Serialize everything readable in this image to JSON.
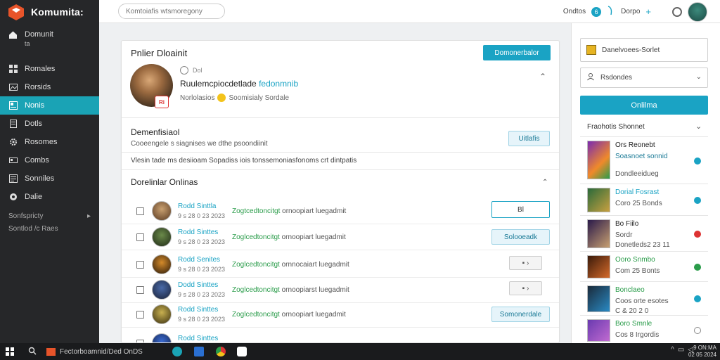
{
  "colors": {
    "accent": "#1aa3c4",
    "sidebar_bg": "#262729",
    "active_nav": "#1aa3b5",
    "green": "#2a9c4a"
  },
  "app": {
    "title": "Komumita:"
  },
  "sidebar": {
    "items": [
      {
        "label": "Domunit",
        "sublabel": "ta",
        "icon": "home-icon"
      },
      {
        "label": "Romales",
        "icon": "grid-icon"
      },
      {
        "label": "Rorsids",
        "icon": "gallery-icon"
      },
      {
        "label": "Nonis",
        "icon": "news-icon",
        "active": true
      },
      {
        "label": "Dotls",
        "icon": "document-icon"
      },
      {
        "label": "Rosomes",
        "icon": "gear-icon"
      },
      {
        "label": "Combs",
        "icon": "card-icon"
      },
      {
        "label": "Sonniles",
        "icon": "list-icon"
      },
      {
        "label": "Dalie",
        "icon": "circle-icon"
      }
    ],
    "group_1": "Sonfspricty",
    "group_2": "Sontlod /c Raes"
  },
  "topbar": {
    "search_placeholder": "Komtoiafis wtsmoregony",
    "link_1": "Ondtos",
    "link_2": "Dorpo"
  },
  "main": {
    "title": "Pnlier Dloainit",
    "primary_button": "Domonerbalor",
    "profile": {
      "meta": "Dol",
      "name": "Ruulemcpiocdetlade",
      "name_link": "fedonmnib",
      "sub_1": "Norlolasios",
      "sub_2": "Soomisialy Sordale",
      "badge": "Ri"
    },
    "section_1": {
      "title": "Demenfisiaol",
      "subtitle": "Cooeengele s siagnises we dthe psoondiinit",
      "button": "Uitlafis"
    },
    "description": "Vlesin tade ms desiioam Sopadiss iois tonssemoniasfonoms crt dintpatis",
    "section_2": {
      "title": "Dorelinlar Onlinas"
    },
    "rows": [
      {
        "name": "Rodd Sinttla",
        "time": "9 s 28 0 23 2023",
        "highlight": "Zogtcedtoncitgt",
        "desc": "ornoopiart luegadmit",
        "action": "Bl",
        "style": "outlined"
      },
      {
        "name": "Rodd Sinttes",
        "time": "9 s 28 0 23 2023",
        "highlight": "Zoglcedtoncitgt",
        "desc": "ornoopiart luegadmit",
        "action": "Solooeadk",
        "style": "soft"
      },
      {
        "name": "Rodd Senites",
        "time": "9 s 28 0 23 2023",
        "highlight": "Zoglcedtoncitgt",
        "desc": "ornnocaiart luegadmit",
        "action": "",
        "style": "grey"
      },
      {
        "name": "Dodd Sinttes",
        "time": "9 s 28 0 23 2023",
        "highlight": "Zoglcedtoncitgt",
        "desc": "ornoopiarst luegadmit",
        "action": "",
        "style": "grey"
      },
      {
        "name": "Rodd Sinttes",
        "time": "9 s 28 0 23 2023",
        "highlight": "Zoglcedtoncitgt",
        "desc": "ornoopiart luegadmit",
        "action": "Somonerdale",
        "style": "soft"
      },
      {
        "name": "Rodd Sinttes",
        "time": "9 s 28 0 23 2023",
        "highlight": "",
        "desc": "",
        "action": "",
        "style": "none"
      }
    ]
  },
  "right": {
    "box_1": "Danelvoees-Sorlet",
    "box_2": "Rsdondes",
    "primary_button": "Onlilma",
    "list_title": "Fraohotis Shonnet",
    "items": [
      {
        "title": "Ors Reonebt",
        "subtitle": "Soasnoet sonnid",
        "meta": "Dondleeidueg",
        "status": "blue"
      },
      {
        "title": "Dorial Fosrast",
        "subtitle": "Coro 25 Bonds",
        "meta": "",
        "status": "blue"
      },
      {
        "title": "Bo Fiilo",
        "subtitle": "Sordr",
        "meta": "Donetleds2 23 11",
        "status": "red"
      },
      {
        "title": "Ooro Snmbo",
        "subtitle": "Com 25 Bonts",
        "meta": "",
        "status": "green"
      },
      {
        "title": "Bonclaeo",
        "subtitle": "Coos orte esotes",
        "meta": "C & 20 2 0",
        "status": "blue"
      },
      {
        "title": "Boro Smnle",
        "subtitle": "Cos 8 Irgordis",
        "meta": "",
        "status": "bell"
      }
    ]
  },
  "taskbar": {
    "app_label": "Fectorboamnid/Ded OnDS",
    "clock_1": "9 ON:MA",
    "clock_2": "02 05 2024"
  }
}
